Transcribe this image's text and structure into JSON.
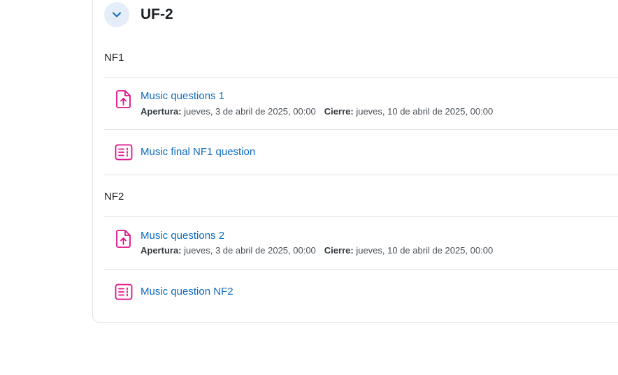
{
  "section": {
    "title": "UF-2",
    "toggle_icon": "chevron-down-icon"
  },
  "colors": {
    "link": "#0f6cbf",
    "icon_accent": "#e0118a",
    "toggle_bg": "#e5eef8",
    "divider": "#dee2e6"
  },
  "subsections": [
    {
      "label": "NF1",
      "activities": [
        {
          "icon": "assignment-upload-icon",
          "title": "Music questions 1",
          "open_label": "Apertura:",
          "open_value": "jueves, 3 de abril de 2025, 00:00",
          "close_label": "Cierre:",
          "close_value": "jueves, 10 de abril de 2025, 00:00"
        },
        {
          "icon": "quiz-list-icon",
          "title": "Music final NF1 question"
        }
      ]
    },
    {
      "label": "NF2",
      "activities": [
        {
          "icon": "assignment-upload-icon",
          "title": "Music questions 2",
          "open_label": "Apertura:",
          "open_value": "jueves, 3 de abril de 2025, 00:00",
          "close_label": "Cierre:",
          "close_value": "jueves, 10 de abril de 2025, 00:00"
        },
        {
          "icon": "quiz-list-icon",
          "title": "Music question NF2"
        }
      ]
    }
  ]
}
